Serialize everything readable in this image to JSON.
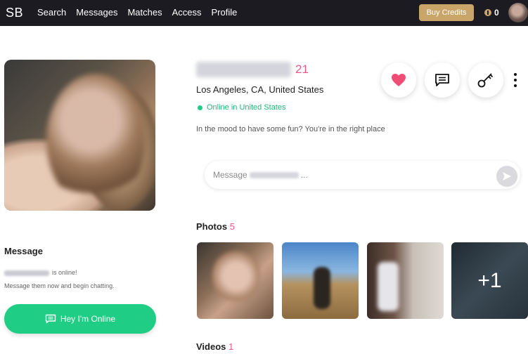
{
  "nav": {
    "logo": "SB",
    "items": [
      "Search",
      "Messages",
      "Matches",
      "Access",
      "Profile"
    ],
    "buy_credits": "Buy Credits",
    "credits": "0"
  },
  "profile": {
    "age": "21",
    "location": "Los Angeles, CA, United States",
    "online_status": "Online in United States",
    "tagline": "In the mood to have some fun? You're in the right place"
  },
  "message_panel": {
    "title": "Message",
    "online_suffix": "is online!",
    "line2": "Message them now and begin chatting.",
    "button_label": "Hey I'm Online"
  },
  "message_box": {
    "prefix": "Message",
    "suffix": "..."
  },
  "photos": {
    "label": "Photos",
    "count": "5",
    "more": "+1"
  },
  "videos": {
    "label": "Videos",
    "count": "1"
  },
  "colors": {
    "accent_green": "#1fcd84",
    "accent_pink": "#e65b86",
    "gold": "#c9a56a",
    "nav_bg": "#1b1b21"
  }
}
